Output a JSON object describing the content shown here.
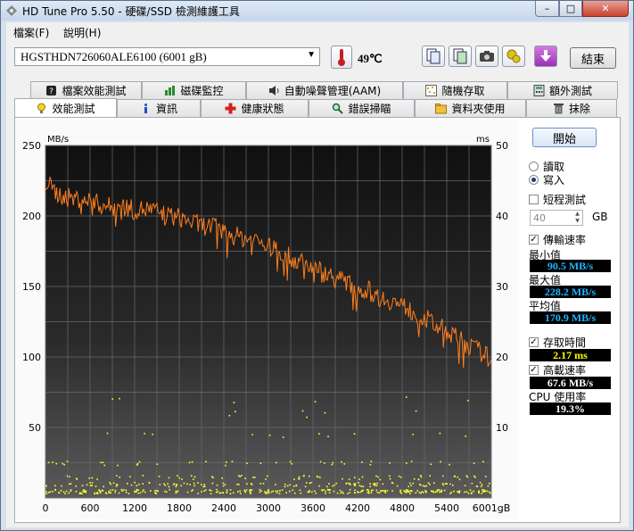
{
  "window": {
    "title": "HD Tune Pro 5.50 - 硬碟/SSD 檢測維護工具",
    "min_label": "–",
    "max_label": "□",
    "close_label": "✕"
  },
  "menu": {
    "file": "檔案(F)",
    "help": "說明(H)"
  },
  "toolbar": {
    "drive": "HGSTHDN726060ALE6100 (6001 gB)",
    "temperature": "49℃",
    "exit_label": "結束"
  },
  "tabs_top": [
    {
      "label": "檔案效能測試",
      "icon": "hourglass-icon"
    },
    {
      "label": "磁碟監控",
      "icon": "bar-graph-icon"
    },
    {
      "label": "自動噪聲管理(AAM)",
      "icon": "speaker-icon"
    },
    {
      "label": "隨機存取",
      "icon": "random-dots-icon"
    },
    {
      "label": "額外測試",
      "icon": "calculator-icon"
    }
  ],
  "tabs_bottom": [
    {
      "label": "效能測試",
      "icon": "lightbulb-icon"
    },
    {
      "label": "資訊",
      "icon": "info-icon"
    },
    {
      "label": "健康狀態",
      "icon": "red-cross-icon"
    },
    {
      "label": "錯誤掃瞄",
      "icon": "magnifier-icon"
    },
    {
      "label": "資料夾使用",
      "icon": "folder-icon"
    },
    {
      "label": "抹除",
      "icon": "trash-icon"
    }
  ],
  "side": {
    "start_label": "開始",
    "read_label": "讀取",
    "write_label": "寫入",
    "short_test_label": "短程測試",
    "gb_value": "40",
    "gb_unit": "GB",
    "transfer_label": "傳輸速率",
    "min_label": "最小值",
    "min_value": "90.5 MB/s",
    "max_label": "最大值",
    "max_value": "228.2 MB/s",
    "avg_label": "平均值",
    "avg_value": "170.9 MB/s",
    "access_label": "存取時間",
    "access_value": "2.17 ms",
    "burst_label": "高載速率",
    "burst_value": "67.6 MB/s",
    "cpu_label": "CPU 使用率",
    "cpu_value": "19.3%"
  },
  "chart_data": {
    "type": "line",
    "y_left_label": "MB/s",
    "y_right_label": "ms",
    "x_ticks": [
      "0",
      "600",
      "1200",
      "1800",
      "2400",
      "3000",
      "3600",
      "4200",
      "4800",
      "5400",
      "6001gB"
    ],
    "y_left_ticks": [
      "250",
      "200",
      "150",
      "100",
      "50"
    ],
    "y_right_ticks": [
      "50",
      "40",
      "30",
      "20",
      "10"
    ],
    "xlim": [
      0,
      6001
    ],
    "ylim_left": [
      0,
      250
    ],
    "ylim_right": [
      0,
      50
    ],
    "grid": true,
    "series": [
      {
        "color": "#ff7f1e",
        "x": [
          0,
          150,
          300,
          450,
          600,
          750,
          900,
          1050,
          1200,
          1350,
          1500,
          1650,
          1800,
          1950,
          2100,
          2250,
          2400,
          2550,
          2700,
          2850,
          3000,
          3150,
          3300,
          3450,
          3600,
          3750,
          3900,
          4050,
          4200,
          4350,
          4500,
          4650,
          4800,
          4950,
          5100,
          5250,
          5400,
          5550,
          5700,
          5850,
          6001
        ],
        "y": [
          224,
          216,
          213,
          212,
          211,
          208,
          206,
          207,
          204,
          205,
          203,
          200,
          199,
          196,
          193,
          193,
          188,
          186,
          184,
          183,
          178,
          176,
          170,
          167,
          164,
          160,
          156,
          153,
          148,
          147,
          142,
          140,
          136,
          132,
          128,
          122,
          119,
          113,
          108,
          104,
          98
        ]
      }
    ],
    "access_points_ms": {
      "color": "#ffff33",
      "band_levels_ms": [
        1,
        2,
        3,
        5,
        9
      ],
      "outlier_levels_ms": [
        12,
        14
      ]
    }
  }
}
